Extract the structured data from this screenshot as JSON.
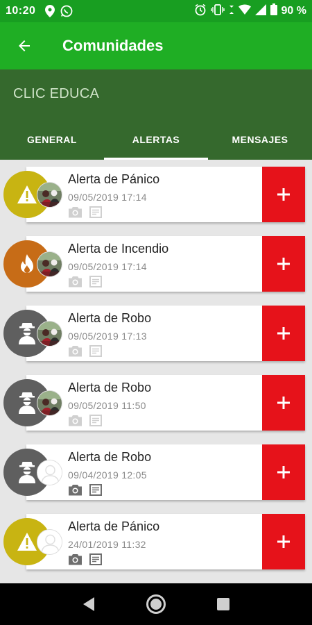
{
  "status_bar": {
    "time": "10:20",
    "battery": "90 %"
  },
  "app_bar": {
    "title": "Comunidades"
  },
  "community": {
    "name": "CLIC EDUCA"
  },
  "tabs": [
    {
      "label": "GENERAL",
      "active": false
    },
    {
      "label": "ALERTAS",
      "active": true
    },
    {
      "label": "MENSAJES",
      "active": false
    }
  ],
  "colors": {
    "primary": "#1fae24",
    "primary_dark": "#35692d",
    "accent_red": "#e6121a",
    "panic": "#c8b412",
    "fire": "#c76c17",
    "robbery": "#5f5f5f"
  },
  "alerts": [
    {
      "title": "Alerta de Pánico",
      "date": "09/05/2019  17:14",
      "type": "panic",
      "icon": "warning-icon",
      "avatar": "photo",
      "attachments_active": false
    },
    {
      "title": "Alerta de Incendio",
      "date": "09/05/2019  17:14",
      "type": "fire",
      "icon": "fire-icon",
      "avatar": "photo",
      "attachments_active": false
    },
    {
      "title": "Alerta de Robo",
      "date": "09/05/2019  17:13",
      "type": "robbery",
      "icon": "thief-icon",
      "avatar": "photo",
      "attachments_active": false
    },
    {
      "title": "Alerta de Robo",
      "date": "09/05/2019  11:50",
      "type": "robbery",
      "icon": "thief-icon",
      "avatar": "photo",
      "attachments_active": false
    },
    {
      "title": "Alerta de Robo",
      "date": "09/04/2019  12:05",
      "type": "robbery",
      "icon": "thief-icon",
      "avatar": "placeholder",
      "attachments_active": true
    },
    {
      "title": "Alerta de Pánico",
      "date": "24/01/2019  11:32",
      "type": "panic",
      "icon": "warning-icon",
      "avatar": "placeholder",
      "attachments_active": true
    }
  ]
}
